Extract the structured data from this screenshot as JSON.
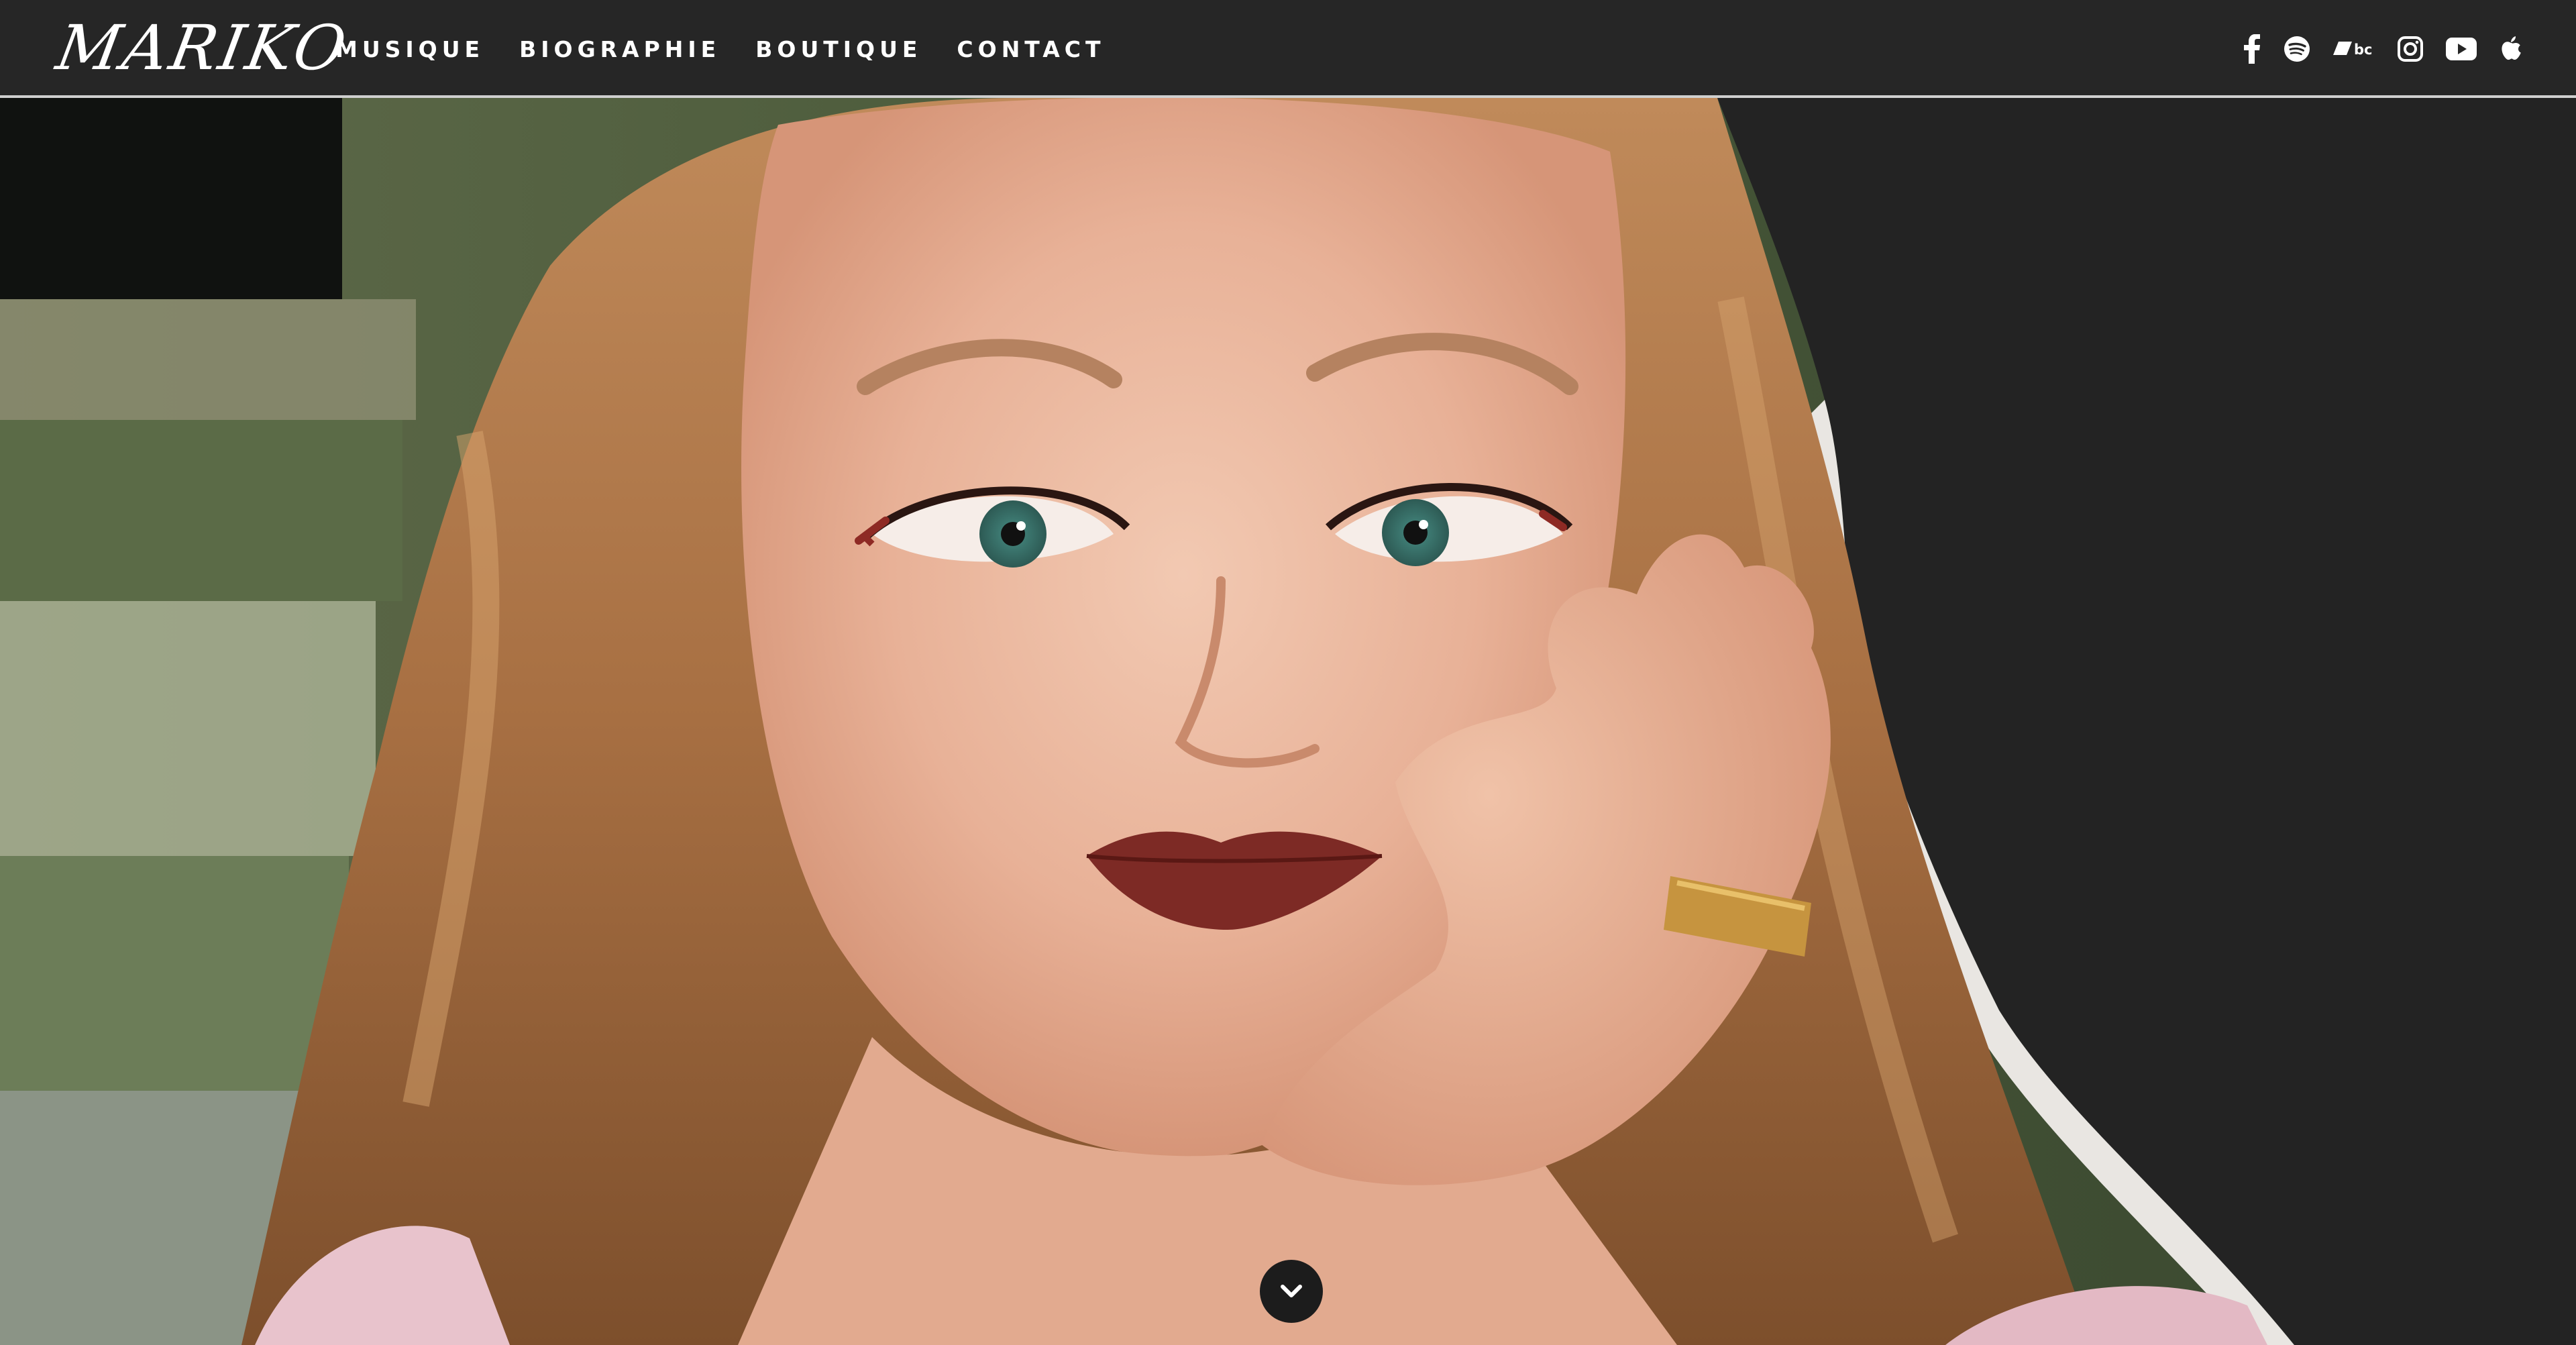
{
  "header": {
    "logo": "MARIKO",
    "nav": [
      {
        "label": "MUSIQUE"
      },
      {
        "label": "BIOGRAPHIE"
      },
      {
        "label": "BOUTIQUE"
      },
      {
        "label": "CONTACT"
      }
    ],
    "social": [
      {
        "icon": "facebook-icon"
      },
      {
        "icon": "spotify-icon"
      },
      {
        "icon": "bandcamp-icon"
      },
      {
        "icon": "instagram-icon"
      },
      {
        "icon": "youtube-icon"
      },
      {
        "icon": "apple-music-icon"
      }
    ]
  },
  "hero": {
    "scroll_icon": "chevron-down-icon"
  },
  "colors": {
    "background": "#242424",
    "header_border": "#cfcfcf",
    "text": "#ffffff",
    "scroll_button": "#1c1c1c"
  }
}
